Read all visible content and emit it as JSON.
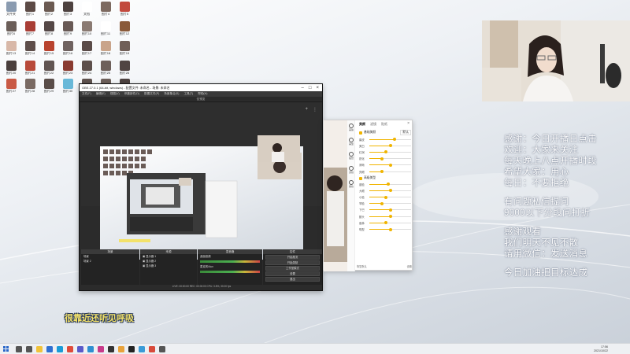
{
  "desktop": {
    "icons": [
      {
        "label": "文件夹",
        "color": "#8a9bb0"
      },
      {
        "label": "图片1",
        "color": "#5c4a45"
      },
      {
        "label": "图片2",
        "color": "#6b5a52"
      },
      {
        "label": "图片3",
        "color": "#4e4240"
      },
      {
        "label": "文档",
        "color": "#ffffff"
      },
      {
        "label": "图片4",
        "color": "#7d6a60"
      },
      {
        "label": "图片5",
        "color": "#c24a3e"
      },
      {
        "label": "图片6",
        "color": "#6a5d58"
      },
      {
        "label": "图片7",
        "color": "#a83d35"
      },
      {
        "label": "图片8",
        "color": "#544746"
      },
      {
        "label": "图片9",
        "color": "#685955"
      },
      {
        "label": "图片10",
        "color": "#8a7a72"
      },
      {
        "label": "图片11",
        "color": "#ffffff"
      },
      {
        "label": "图片12",
        "color": "#8a5a3a"
      },
      {
        "label": "图片13",
        "color": "#d8b8a8"
      },
      {
        "label": "图片14",
        "color": "#5e4e4a"
      },
      {
        "label": "图片15",
        "color": "#b8432f"
      },
      {
        "label": "图片16",
        "color": "#6f6260"
      },
      {
        "label": "图片17",
        "color": "#5a4b48"
      },
      {
        "label": "图片18",
        "color": "#c9a48a"
      },
      {
        "label": "图片19",
        "color": "#705f58"
      },
      {
        "label": "图片20",
        "color": "#4a3f3d"
      },
      {
        "label": "图片21",
        "color": "#b84a3a"
      },
      {
        "label": "图片22",
        "color": "#615552"
      },
      {
        "label": "图片23",
        "color": "#8a3a30"
      },
      {
        "label": "图片24",
        "color": "#5d4f4b"
      },
      {
        "label": "图片25",
        "color": "#6d5f5a"
      },
      {
        "label": "图片26",
        "color": "#504442"
      },
      {
        "label": "图片27",
        "color": "#c95a45"
      },
      {
        "label": "图片28",
        "color": "#7a6a63"
      },
      {
        "label": "图片29",
        "color": "#5a4d49"
      },
      {
        "label": "图片30",
        "color": "#68b8d8"
      },
      {
        "label": "图片31",
        "color": "#5f524e"
      },
      {
        "label": "图片32",
        "color": "#6e605b"
      },
      {
        "label": "图片33",
        "color": "#4d4240"
      }
    ]
  },
  "obs": {
    "title": "OBS 27.0.1 (64-bit, windows) - 配置文件: 未命名 - 场景: 未命名",
    "menu": [
      "文件(F)",
      "编辑(E)",
      "视图(V)",
      "停靠部件(D)",
      "配置文件(P)",
      "场景集合(S)",
      "工具(T)",
      "帮助(H)"
    ],
    "preview_label": "仅预览",
    "docks": {
      "scenes": {
        "title": "场景",
        "items": [
          "场景",
          "场景 2"
        ]
      },
      "sources": {
        "title": "来源",
        "items": [
          "显示器 1",
          "显示器 2",
          "显示器 3"
        ]
      },
      "mixer": {
        "title": "混音器",
        "tracks": [
          "桌面音频",
          "麦克风/Aux"
        ]
      },
      "controls": {
        "title": "控件",
        "buttons": [
          "开始推流",
          "开始录制",
          "工作室模式",
          "设置",
          "退出"
        ]
      }
    },
    "status": "LIVE: 00:00:00   REC: 00:00:00   CPU: 3.8%, 30.00 fps"
  },
  "beauty": {
    "tabs": [
      "美颜",
      "滤镜",
      "贴纸"
    ],
    "nav": [
      "美肤",
      "美型",
      "贴纸",
      "滤镜",
      "美妆"
    ],
    "section1": "基础美颜",
    "section2": "高级美型",
    "preset": "默认",
    "sliders1": [
      {
        "name": "磨皮",
        "value": 0.6
      },
      {
        "name": "美白",
        "value": 0.5
      },
      {
        "name": "红润",
        "value": 0.4
      },
      {
        "name": "锐化",
        "value": 0.3
      },
      {
        "name": "清晰",
        "value": 0.5
      },
      {
        "name": "亮眼",
        "value": 0.3
      }
    ],
    "sliders2": [
      {
        "name": "瘦脸",
        "value": 0.45
      },
      {
        "name": "大眼",
        "value": 0.5
      },
      {
        "name": "小脸",
        "value": 0.4
      },
      {
        "name": "窄脸",
        "value": 0.3
      },
      {
        "name": "下巴",
        "value": 0.5
      },
      {
        "name": "额头",
        "value": 0.5
      },
      {
        "name": "瘦鼻",
        "value": 0.4
      },
      {
        "name": "嘴型",
        "value": 0.5
      }
    ],
    "footer_left": "恢复默认",
    "footer_right": "设置"
  },
  "notes": [
    "感谢：今日开播日点击",
    "欢迎：大家来关注",
    "每天晚上八点开播时段",
    "希望大家：用心",
    "每日：不要拒绝",
    "有问题私信提问",
    "9000以下分段问打折",
    "感谢观看",
    "我们明天不见不散",
    "请用微信：发送消息",
    "今日加油把目标达成"
  ],
  "caption": "很靠近还听见呼吸",
  "taskbar": {
    "time": "17:56",
    "date": "2021/10/22",
    "apps": [
      {
        "name": "search-icon",
        "color": "#555555"
      },
      {
        "name": "task-view-icon",
        "color": "#555555"
      },
      {
        "name": "explorer-icon",
        "color": "#f0c23a"
      },
      {
        "name": "mail-icon",
        "color": "#2f6fd1"
      },
      {
        "name": "edge-icon",
        "color": "#1a9bd7"
      },
      {
        "name": "chrome-icon",
        "color": "#e04a3a"
      },
      {
        "name": "teams-icon",
        "color": "#5a5ac9"
      },
      {
        "name": "store-icon",
        "color": "#2f8fd1"
      },
      {
        "name": "photos-icon",
        "color": "#c83a8a"
      },
      {
        "name": "media-icon",
        "color": "#333333"
      },
      {
        "name": "beauty-app-icon",
        "color": "#e8a23a"
      },
      {
        "name": "obs-icon",
        "color": "#222222"
      },
      {
        "name": "qq-icon",
        "color": "#3a9bd7"
      },
      {
        "name": "music-icon",
        "color": "#d84a3a"
      },
      {
        "name": "settings-icon",
        "color": "#555555"
      }
    ]
  }
}
